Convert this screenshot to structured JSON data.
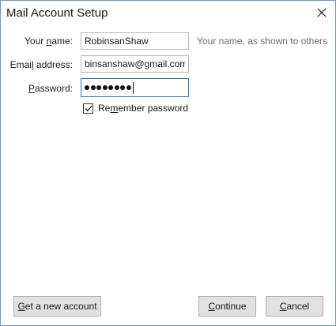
{
  "window": {
    "title": "Mail Account Setup"
  },
  "form": {
    "name_label_pre": "Your ",
    "name_label_key": "n",
    "name_label_post": "ame:",
    "name_value": "RobinsanShaw",
    "name_hint": "Your name, as shown to others",
    "email_label_pre": "Emai",
    "email_label_key": "l",
    "email_label_post": " address:",
    "email_value": "binsanshaw@gmail.com",
    "password_label_key": "P",
    "password_label_post": "assword:",
    "password_length": 8,
    "remember_label_pre": "Re",
    "remember_label_key": "m",
    "remember_label_post": "ember password",
    "remember_checked": true
  },
  "buttons": {
    "new_account_key": "G",
    "new_account_post": "et a new account",
    "continue_key": "C",
    "continue_post": "ontinue",
    "cancel_key": "C",
    "cancel_post": "ancel"
  }
}
